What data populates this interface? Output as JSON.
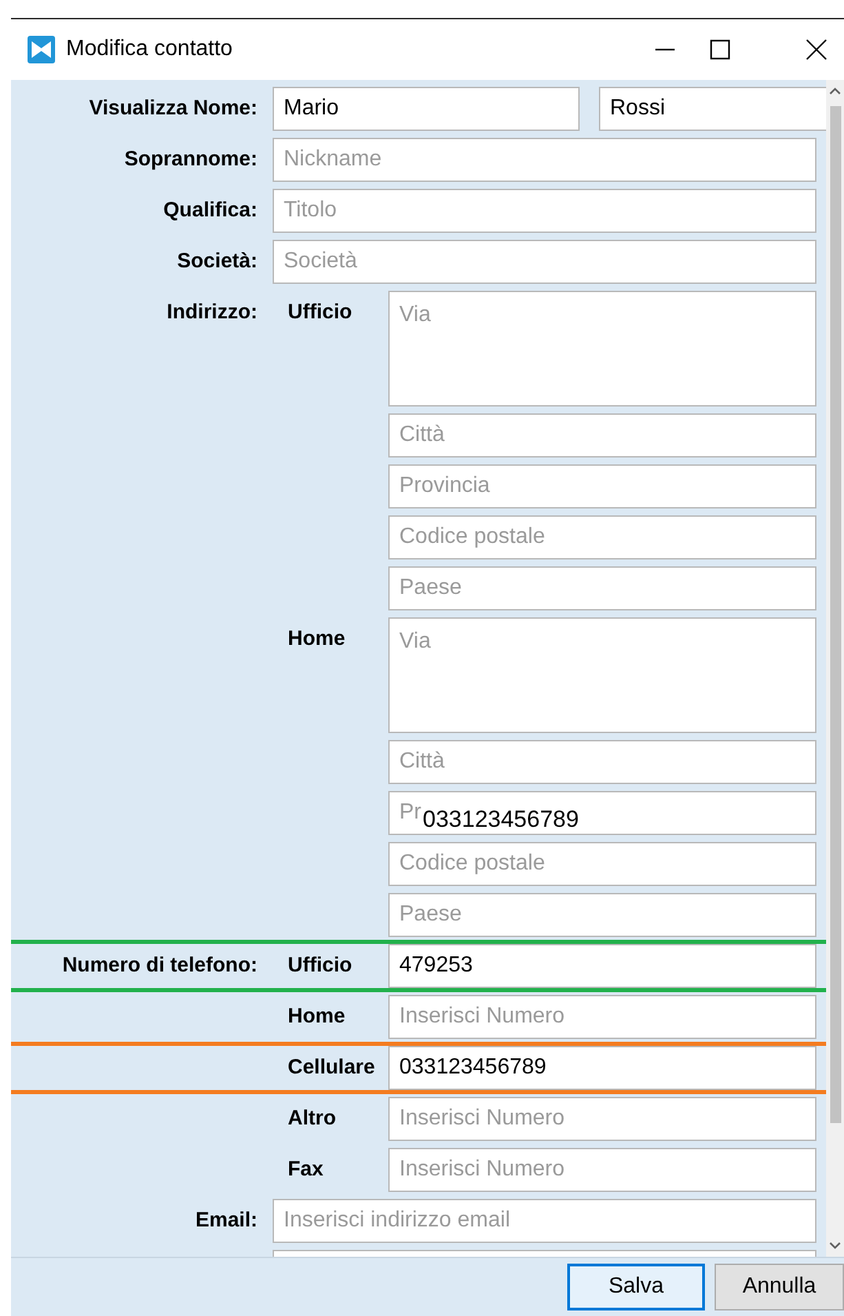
{
  "window": {
    "title": "Modifica contatto"
  },
  "name": {
    "label": "Visualizza Nome:",
    "first": {
      "value": "Mario"
    },
    "last": {
      "value": "Rossi"
    }
  },
  "fields": [
    {
      "label": "Soprannome:",
      "placeholder": "Nickname"
    },
    {
      "label": "Qualifica:",
      "placeholder": "Titolo"
    },
    {
      "label": "Società:",
      "placeholder": "Società"
    }
  ],
  "address": {
    "label": "Indirizzo:",
    "groups": [
      {
        "label": "Ufficio",
        "street": {
          "placeholder": "Via"
        },
        "fields": [
          {
            "placeholder": "Città"
          },
          {
            "placeholder": "Provincia"
          },
          {
            "placeholder": "Codice postale"
          },
          {
            "placeholder": "Paese"
          }
        ]
      },
      {
        "label": "Home",
        "street": {
          "placeholder": "Via"
        },
        "fields": [
          {
            "placeholder": "Città"
          },
          {
            "placeholder": "Pr",
            "overlay": "033123456789"
          },
          {
            "placeholder": "Codice postale"
          },
          {
            "placeholder": "Paese"
          }
        ]
      }
    ]
  },
  "phones": {
    "label": "Numero di telefono:",
    "items": [
      {
        "label": "Ufficio",
        "value": "479253",
        "color": "#22b14c"
      },
      {
        "label": "Home",
        "placeholder": "Inserisci Numero"
      },
      {
        "label": "Cellulare",
        "value": "033123456789",
        "color": "#f47c20"
      },
      {
        "label": "Altro",
        "placeholder": "Inserisci Numero"
      },
      {
        "label": "Fax",
        "placeholder": "Inserisci Numero"
      }
    ]
  },
  "email": {
    "label": "Email:",
    "placeholder": "Inserisci indirizzo email"
  },
  "buttons": [
    {
      "label": "Salva",
      "default": true
    },
    {
      "label": "Annulla",
      "default": false
    }
  ]
}
